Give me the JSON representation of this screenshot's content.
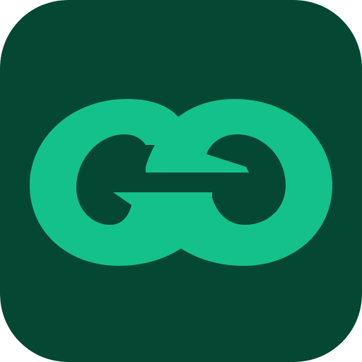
{
  "icon": {
    "name": "go-infinity-logo",
    "colors": {
      "background": "#044733",
      "glyph": "#14c18b"
    }
  }
}
